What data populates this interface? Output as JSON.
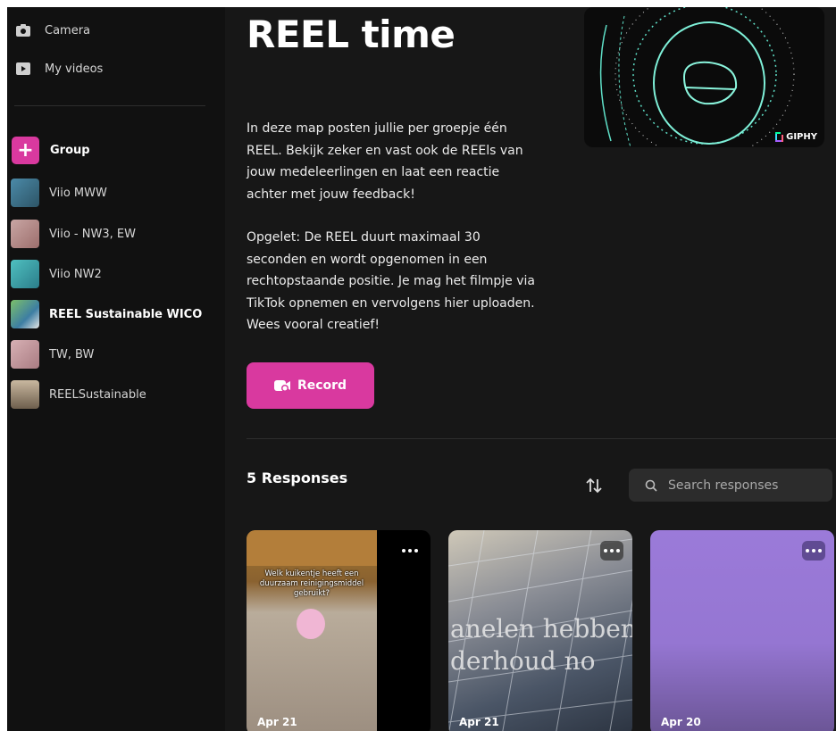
{
  "sidebar": {
    "camera_label": "Camera",
    "videos_label": "My videos",
    "group_label": "Group",
    "groups": [
      {
        "label": "Viio MWW",
        "color": "#3f6f86"
      },
      {
        "label": "Viio - NW3, EW",
        "color": "#b78e8c"
      },
      {
        "label": "Viio NW2",
        "color": "#3fa3a8"
      },
      {
        "label": "REEL Sustainable WICO",
        "color": "#5a9a4e"
      },
      {
        "label": "TW, BW",
        "color": "#c59a9e"
      },
      {
        "label": "REELSustainable",
        "color": "#8a7d6a"
      }
    ]
  },
  "main": {
    "title": "REEL time",
    "description_1": "In deze map posten jullie per groepje één REEL. Bekijk zeker en vast ook de REEls van jouw medeleerlingen en laat een reactie achter met jouw feedback!",
    "description_2": "Opgelet: De REEL duurt maximaal 30 seconden en wordt opgenomen in een rechtopstaande positie. Je mag het filmpje via TikTok opnemen en vervolgens hier uploaden. Wees vooral creatief!",
    "giphy_label": "GIPHY",
    "record_label": "Record",
    "responses_title": "5 Responses",
    "search_placeholder": "Search responses"
  },
  "cards": [
    {
      "date": "Apr 21",
      "caption": "Welk kuikentje heeft een duurzaam reinigingsmiddel gebruikt?"
    },
    {
      "date": "Apr 21",
      "overlay_line_1": "anelen hebben",
      "overlay_line_2": "derhoud no"
    },
    {
      "date": "Apr 20"
    }
  ],
  "colors": {
    "accent": "#d9399f",
    "background": "#171717",
    "sidebar": "#111111",
    "card_purple": "#9a78d6"
  }
}
